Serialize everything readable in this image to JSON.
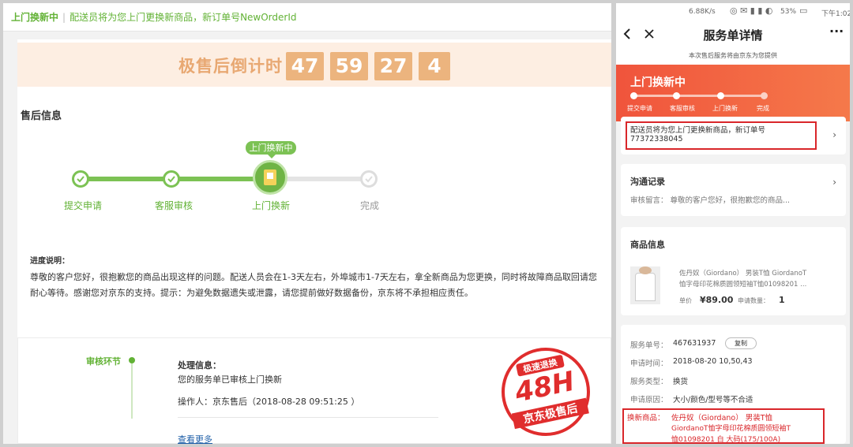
{
  "left": {
    "topbar": {
      "title": "上门换新中",
      "sep": "|",
      "message": "配送员将为您上门更换新商品，新订单号NewOrderId"
    },
    "countdown": {
      "label": "极售后倒计时",
      "values": [
        "47",
        "59",
        "27",
        "4"
      ]
    },
    "section_title": "售后信息",
    "steps": [
      {
        "label": "提交申请",
        "done": true
      },
      {
        "label": "客服审核",
        "done": true
      },
      {
        "label": "上门换新",
        "current": true
      },
      {
        "label": "完成",
        "done": false
      }
    ],
    "current_bubble": "上门换新中",
    "progress_note": {
      "heading": "进度说明：",
      "line1": "尊敬的客户您好，很抱歉您的商品出现这样的问题。配送人员会在1-3天左右，外埠城市1-7天左右，拿全新商品为您更换，同时将故障商品取回请您",
      "line2": "耐心等待。感谢您对京东的支持。提示：为避免数据遗失或泄露，请您提前做好数据备份，京东将不承担相应责任。"
    },
    "audit": {
      "label": "审核环节",
      "info_title": "处理信息：",
      "info_text": "您的服务单已审核上门换新",
      "operator": "操作人：京东售后（2018-08-28 09:51:25 ）",
      "more_link": "查看更多"
    },
    "seal": {
      "top": "极速退换",
      "mid": "48H",
      "bottom": "京东极售后"
    }
  },
  "right": {
    "status_bar": {
      "speed": "6.88K/s",
      "battery": "53%",
      "time": "下午1:02"
    },
    "nav_title": "服务单详情",
    "subtitle": "本次售后服务将由京东为您提供",
    "status": "上门换新中",
    "steps": [
      "提交申请",
      "客服审核",
      "上门换新",
      "完成"
    ],
    "notice_line1": "配送员将为您上门更换新商品，新订单号",
    "notice_line2": "77372338045",
    "comm_title": "沟通记录",
    "comm_text": "审核留言： 尊敬的客户您好，很抱歉您的商品...",
    "goods_title": "商品信息",
    "goods_name1": "佐丹奴（Giordano） 男装T恤 GiordanoT",
    "goods_name2": "恤字母印花棉质圆领短袖T恤01098201 ...",
    "price_label": "单价",
    "price": "¥89.00",
    "qty_label": "申请数量：",
    "qty": "1",
    "detail": {
      "no_label": "服务单号：",
      "no": "467631937",
      "copy": "复制",
      "time_label": "申请时间：",
      "time": "2018-08-20  10,50,43",
      "type_label": "服务类型：",
      "type": "换货",
      "reason_label": "申请原因：",
      "reason": "大小/颜色/型号等不合适",
      "new_label": "换新商品：",
      "new_line1": "佐丹奴（Giordano） 男装T恤",
      "new_line2": "GiordanoT恤字母印花棉质圆领短袖T",
      "new_line3": "恤01098201  白  大码(175/100A)"
    }
  }
}
